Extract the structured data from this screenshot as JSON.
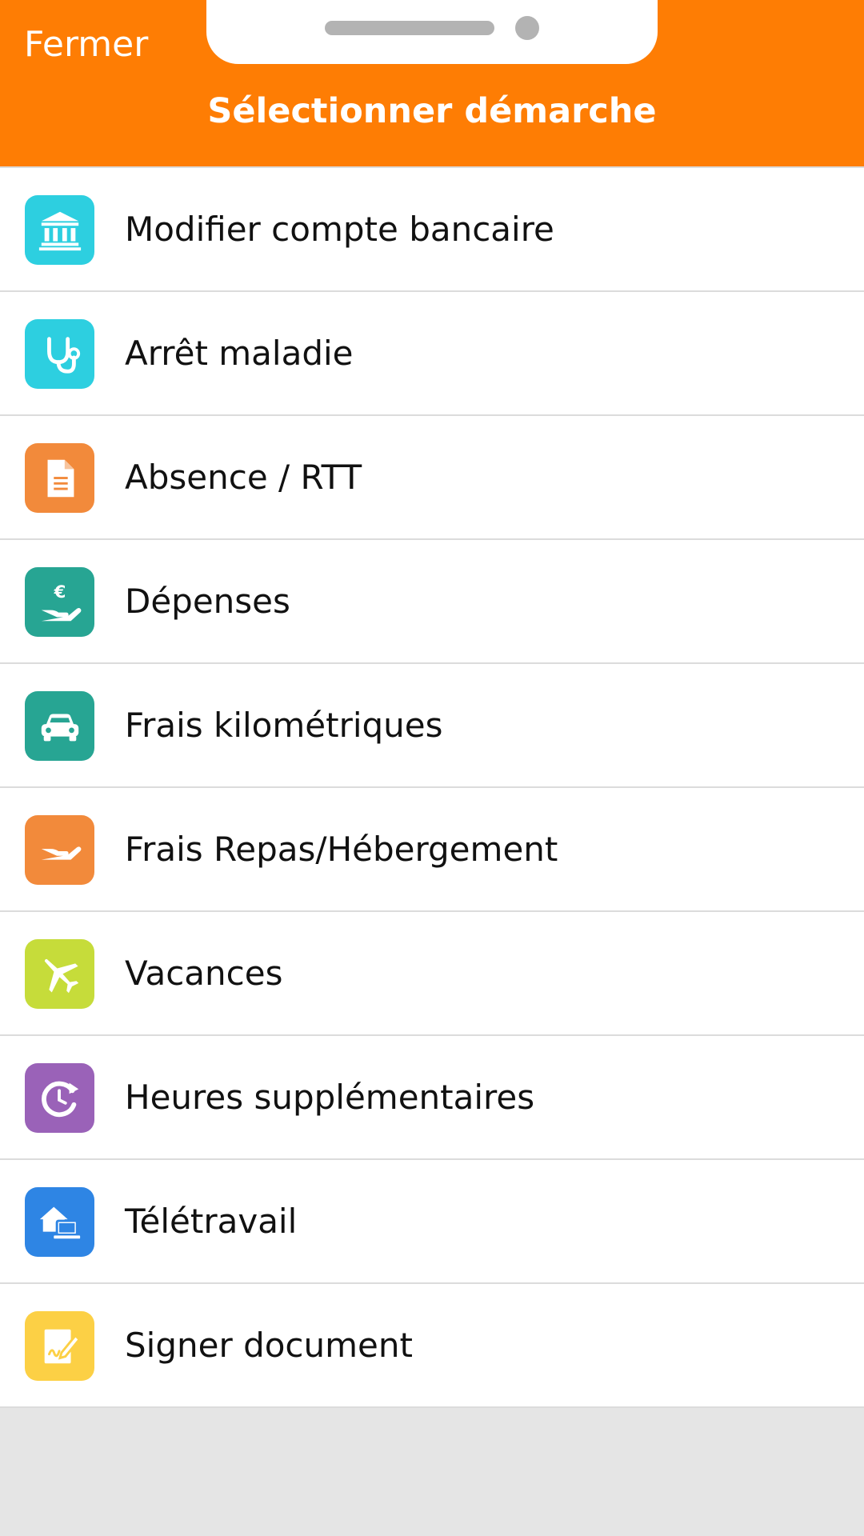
{
  "header": {
    "close_label": "Fermer",
    "title": "Sélectionner démarche",
    "background_color": "#fe7d04"
  },
  "items": [
    {
      "label": "Modifier compte bancaire",
      "icon": "bank-icon",
      "color": "#2dcfe0"
    },
    {
      "label": "Arrêt maladie",
      "icon": "stethoscope-icon",
      "color": "#2dcfe0"
    },
    {
      "label": "Absence / RTT",
      "icon": "document-icon",
      "color": "#f28a3b"
    },
    {
      "label": "Dépenses",
      "icon": "euro-hand-icon",
      "color": "#27a593"
    },
    {
      "label": "Frais kilométriques",
      "icon": "car-icon",
      "color": "#27a593"
    },
    {
      "label": "Frais Repas/Hébergement",
      "icon": "hand-icon",
      "color": "#f28a3b"
    },
    {
      "label": "Vacances",
      "icon": "plane-icon",
      "color": "#c6dc3a"
    },
    {
      "label": "Heures supplémentaires",
      "icon": "clock-arrow-icon",
      "color": "#9a62b8"
    },
    {
      "label": "Télétravail",
      "icon": "home-laptop-icon",
      "color": "#2e85e4"
    },
    {
      "label": "Signer document",
      "icon": "sign-document-icon",
      "color": "#fcd045"
    }
  ]
}
